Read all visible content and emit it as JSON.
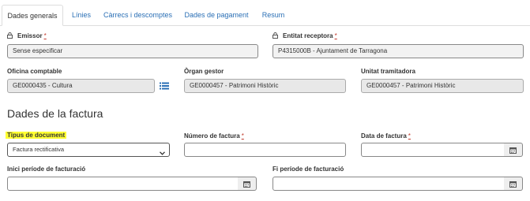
{
  "tabs": [
    {
      "label": "Dades generals",
      "active": true
    },
    {
      "label": "Línies"
    },
    {
      "label": "Càrrecs i descomptes"
    },
    {
      "label": "Dades de pagament"
    },
    {
      "label": "Resum"
    }
  ],
  "emissor": {
    "label": "Emissor",
    "required": "*",
    "value": "Sense especificar"
  },
  "entitat": {
    "label": "Entitat receptora",
    "required": "*",
    "value": "P4315000B - Ajuntament de Tarragona"
  },
  "oficina": {
    "label": "Oficina comptable",
    "value": "GE0000435 - Cultura"
  },
  "organ": {
    "label": "Òrgan gestor",
    "value": "GE0000457 - Patrimoni Històric"
  },
  "unitat": {
    "label": "Unitat tramitadora",
    "value": "GE0000457 - Patrimoni Històric"
  },
  "section_title": "Dades de la factura",
  "tipus": {
    "label": "Tipus de document",
    "value": "Factura rectificativa"
  },
  "numero": {
    "label": "Número de factura",
    "required": "*",
    "value": ""
  },
  "data_factura": {
    "label": "Data de factura",
    "required": "*",
    "value": ""
  },
  "inici": {
    "label": "Inici període de facturació",
    "value": ""
  },
  "fi": {
    "label": "Fi període de facturació",
    "value": ""
  },
  "colors": {
    "link": "#2a6fb5",
    "required": "#c0392b",
    "highlight": "#ffff33"
  }
}
